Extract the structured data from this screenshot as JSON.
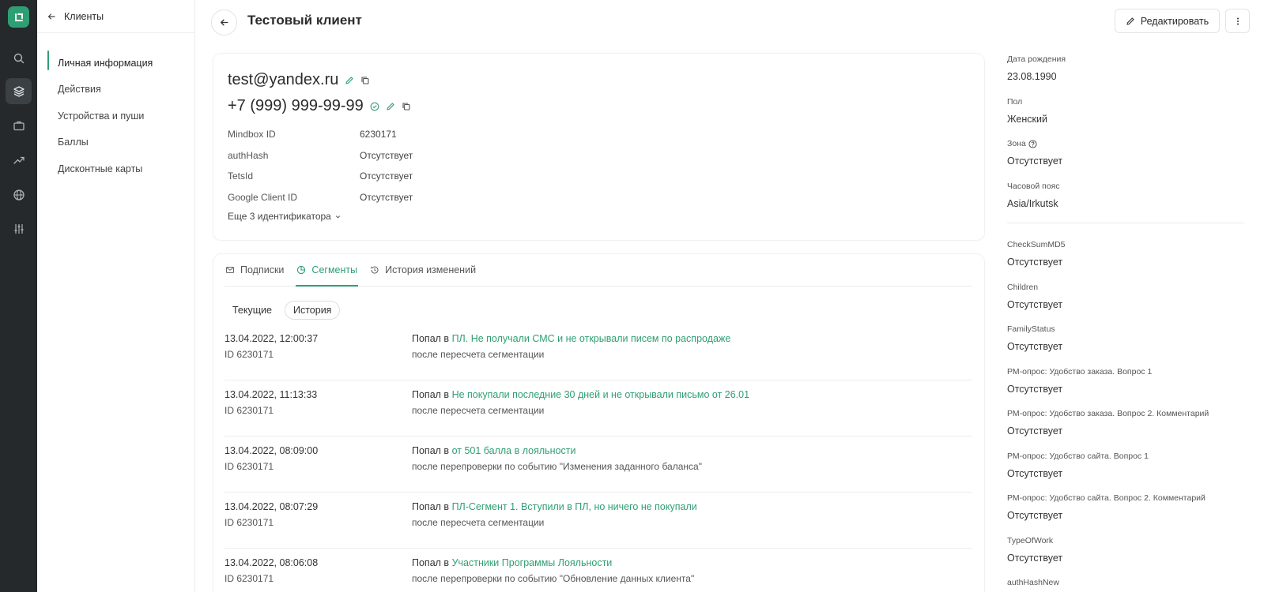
{
  "section_title": "Клиенты",
  "sidebar": {
    "items": [
      {
        "label": "Личная информация",
        "active": true
      },
      {
        "label": "Действия",
        "active": false
      },
      {
        "label": "Устройства и пуши",
        "active": false
      },
      {
        "label": "Баллы",
        "active": false
      },
      {
        "label": "Дисконтные карты",
        "active": false
      }
    ]
  },
  "rail_icons": [
    "search-icon",
    "layers-icon",
    "briefcase-icon",
    "trend-icon",
    "globe-icon",
    "sliders-icon"
  ],
  "header": {
    "title": "Тестовый клиент",
    "edit_label": "Редактировать"
  },
  "contacts": {
    "email": "test@yandex.ru",
    "phone": "+7 (999) 999-99-99"
  },
  "identifiers": [
    {
      "key": "Mindbox ID",
      "value": "6230171"
    },
    {
      "key": "authHash",
      "value": "Отсутствует"
    },
    {
      "key": "TetsId",
      "value": "Отсутствует"
    },
    {
      "key": "Google Client ID",
      "value": "Отсутствует"
    }
  ],
  "more_identifiers": "Еще 3 идентификатора",
  "tabs": [
    {
      "label": "Подписки",
      "active": false
    },
    {
      "label": "Сегменты",
      "active": true
    },
    {
      "label": "История изменений",
      "active": false
    }
  ],
  "subtabs": [
    {
      "label": "Текущие",
      "active": false
    },
    {
      "label": "История",
      "active": true
    }
  ],
  "events": [
    {
      "datetime": "13.04.2022, 12:00:37",
      "id": "ID 6230171",
      "prefix": "Попал в",
      "segment": "ПЛ. Не получали СМС и не открывали писем по распродаже",
      "reason": "после пересчета сегментации"
    },
    {
      "datetime": "13.04.2022, 11:13:33",
      "id": "ID 6230171",
      "prefix": "Попал в",
      "segment": "Не покупали последние 30 дней и не открывали письмо от 26.01",
      "reason": "после пересчета сегментации"
    },
    {
      "datetime": "13.04.2022, 08:09:00",
      "id": "ID 6230171",
      "prefix": "Попал в",
      "segment": "от 501 балла в лояльности",
      "reason": "после перепроверки по событию \"Изменения заданного баланса\""
    },
    {
      "datetime": "13.04.2022, 08:07:29",
      "id": "ID 6230171",
      "prefix": "Попал в",
      "segment": "ПЛ-Сегмент 1. Вступили в ПЛ, но ничего не покупали",
      "reason": "после пересчета сегментации"
    },
    {
      "datetime": "13.04.2022, 08:06:08",
      "id": "ID 6230171",
      "prefix": "Попал в",
      "segment": "Участники Программы Лояльности",
      "reason": "после перепроверки по событию \"Обновление данных клиента\""
    }
  ],
  "attributes_main": [
    {
      "label": "Дата рождения",
      "value": "23.08.1990"
    },
    {
      "label": "Пол",
      "value": "Женский"
    },
    {
      "label": "Зона",
      "value": "Отсутствует",
      "help": true
    },
    {
      "label": "Часовой пояс",
      "value": "Asia/Irkutsk"
    }
  ],
  "attributes_custom": [
    {
      "label": "CheckSumMD5",
      "value": "Отсутствует"
    },
    {
      "label": "Children",
      "value": "Отсутствует"
    },
    {
      "label": "FamilyStatus",
      "value": "Отсутствует"
    },
    {
      "label": "РМ-опрос: Удобство заказа. Вопрос 1",
      "value": "Отсутствует"
    },
    {
      "label": "РМ-опрос: Удобство заказа. Вопрос 2. Комментарий",
      "value": "Отсутствует"
    },
    {
      "label": "РМ-опрос: Удобство сайта. Вопрос 1",
      "value": "Отсутствует"
    },
    {
      "label": "РМ-опрос: Удобство сайта. Вопрос 2. Комментарий",
      "value": "Отсутствует"
    },
    {
      "label": "TypeOfWork",
      "value": "Отсутствует"
    },
    {
      "label": "authHashNew",
      "value": ""
    }
  ],
  "colors": {
    "accent": "#2e9f73",
    "rail": "#25292c"
  }
}
